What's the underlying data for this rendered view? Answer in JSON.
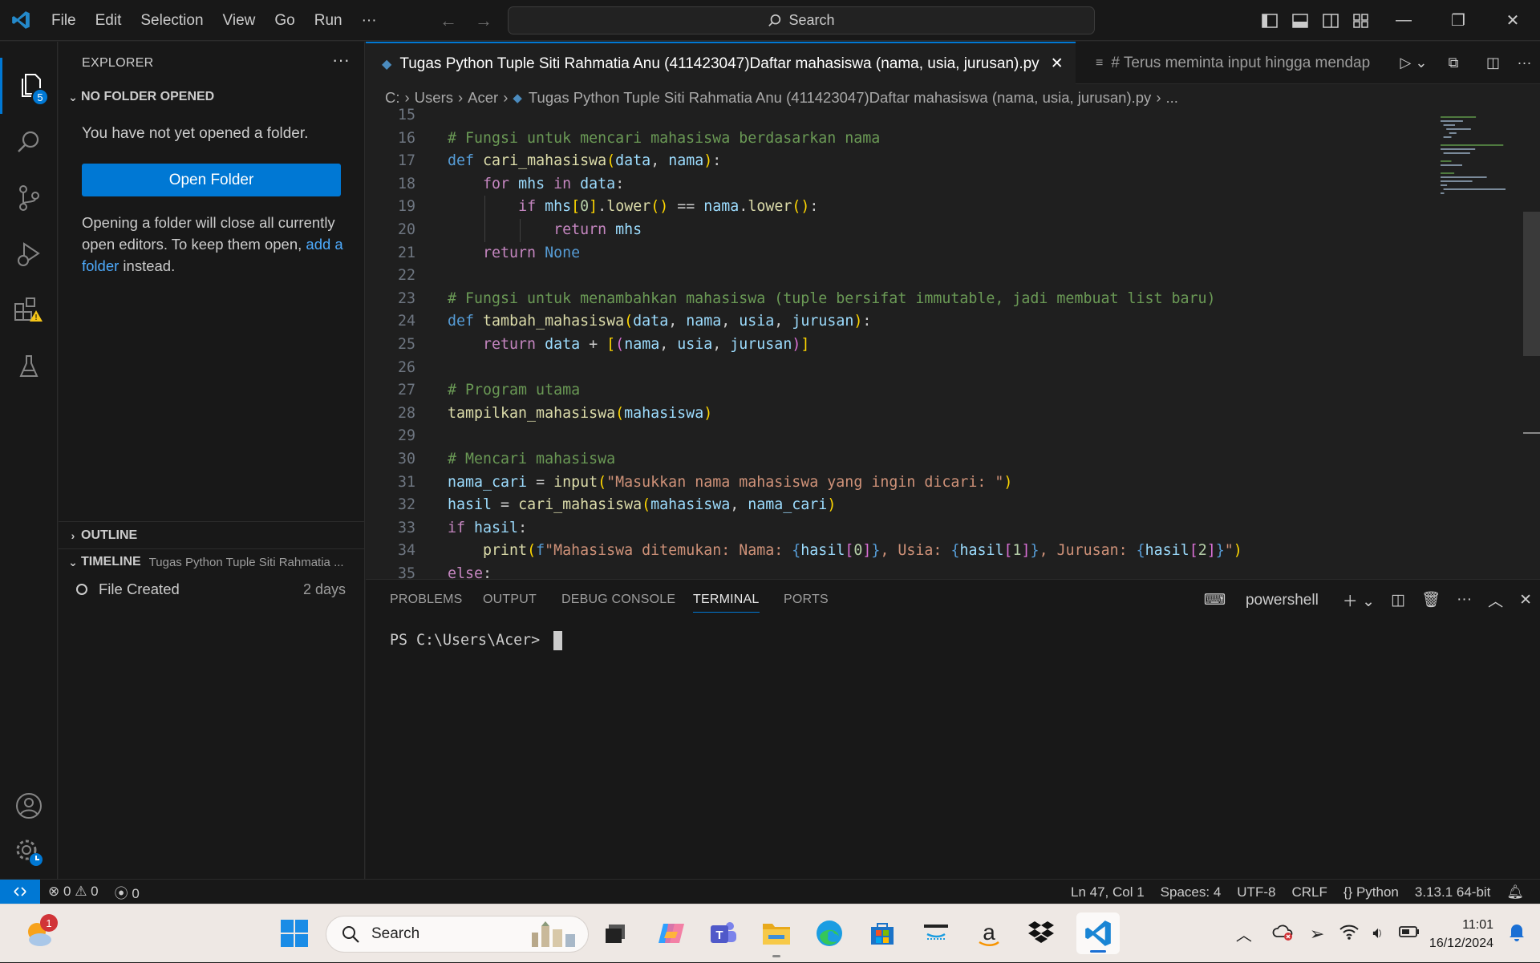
{
  "titlebar": {
    "menu": [
      "File",
      "Edit",
      "Selection",
      "View",
      "Go",
      "Run",
      "···"
    ],
    "search_label": "Search"
  },
  "activity": {
    "explorer_badge": "5"
  },
  "sidebar": {
    "header": "EXPLORER",
    "no_folder_title": "NO FOLDER OPENED",
    "no_folder_text": "You have not yet opened a folder.",
    "open_folder_label": "Open Folder",
    "note_before": "Opening a folder will close all currently open editors. To keep them open, ",
    "note_link": "add a folder",
    "note_after": " instead.",
    "outline_title": "OUTLINE",
    "timeline_title": "TIMELINE",
    "timeline_file": "Tugas Python Tuple Siti Rahmatia ...",
    "timeline_entry": "File Created",
    "timeline_age": "2 days"
  },
  "editor": {
    "tab_active": "Tugas Python Tuple Siti Rahmatia Anu (411423047)Daftar mahasiswa (nama, usia, jurusan).py",
    "tab_second": "# Terus meminta input hingga mendap",
    "breadcrumb": [
      "C:",
      "Users",
      "Acer",
      "Tugas Python Tuple Siti Rahmatia Anu (411423047)Daftar mahasiswa (nama, usia, jurusan).py",
      "..."
    ],
    "lines": [
      {
        "n": "15",
        "code": ""
      },
      {
        "n": "16",
        "code": "# Fungsi untuk mencari mahasiswa berdasarkan nama"
      },
      {
        "n": "17",
        "code": "def cari_mahasiswa(data, nama):"
      },
      {
        "n": "18",
        "code": "    for mhs in data:"
      },
      {
        "n": "19",
        "code": "        if mhs[0].lower() == nama.lower():"
      },
      {
        "n": "20",
        "code": "            return mhs"
      },
      {
        "n": "21",
        "code": "    return None"
      },
      {
        "n": "22",
        "code": ""
      },
      {
        "n": "23",
        "code": "# Fungsi untuk menambahkan mahasiswa (tuple bersifat immutable, jadi membuat list baru)"
      },
      {
        "n": "24",
        "code": "def tambah_mahasiswa(data, nama, usia, jurusan):"
      },
      {
        "n": "25",
        "code": "    return data + [(nama, usia, jurusan)]"
      },
      {
        "n": "26",
        "code": ""
      },
      {
        "n": "27",
        "code": "# Program utama"
      },
      {
        "n": "28",
        "code": "tampilkan_mahasiswa(mahasiswa)"
      },
      {
        "n": "29",
        "code": ""
      },
      {
        "n": "30",
        "code": "# Mencari mahasiswa"
      },
      {
        "n": "31",
        "code": "nama_cari = input(\"Masukkan nama mahasiswa yang ingin dicari: \")"
      },
      {
        "n": "32",
        "code": "hasil = cari_mahasiswa(mahasiswa, nama_cari)"
      },
      {
        "n": "33",
        "code": "if hasil:"
      },
      {
        "n": "34",
        "code": "    print(f\"Mahasiswa ditemukan: Nama: {hasil[0]}, Usia: {hasil[1]}, Jurusan: {hasil[2]}\")"
      },
      {
        "n": "35",
        "code": "else:"
      }
    ]
  },
  "panel": {
    "tabs": [
      "PROBLEMS",
      "OUTPUT",
      "DEBUG CONSOLE",
      "TERMINAL",
      "PORTS"
    ],
    "shell": "powershell",
    "prompt": "PS C:\\Users\\Acer> "
  },
  "status": {
    "errors": "0",
    "warnings": "0",
    "ports": "0",
    "position": "Ln 47, Col 1",
    "spaces": "Spaces: 4",
    "encoding": "UTF-8",
    "eol": "CRLF",
    "language": "Python",
    "interpreter": "3.13.1 64-bit"
  },
  "taskbar": {
    "search_label": "Search",
    "weather_badge": "1",
    "time": "11:01",
    "date": "16/12/2024"
  },
  "colors": {
    "accent": "#0078d4",
    "warning": "#f5c518"
  }
}
